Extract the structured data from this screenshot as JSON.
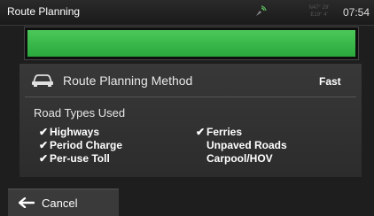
{
  "header": {
    "title": "Route Planning",
    "gps_coords": [
      "N47° 29'",
      "E19° 4'"
    ],
    "clock": "07:54"
  },
  "progress": {
    "fill_fraction": 1.0,
    "color": "#3bbf4b"
  },
  "route_method": {
    "label": "Route Planning Method",
    "value": "Fast",
    "icon": "car-icon"
  },
  "road_types": {
    "heading": "Road Types Used",
    "items": [
      {
        "label": "Highways",
        "checked": true
      },
      {
        "label": "Period Charge",
        "checked": true
      },
      {
        "label": "Per-use Toll",
        "checked": true
      },
      {
        "label": "Ferries",
        "checked": true
      },
      {
        "label": "Unpaved Roads",
        "checked": false
      },
      {
        "label": "Carpool/HOV",
        "checked": false
      }
    ]
  },
  "footer": {
    "cancel_label": "Cancel",
    "icon": "back-arrow-icon"
  }
}
